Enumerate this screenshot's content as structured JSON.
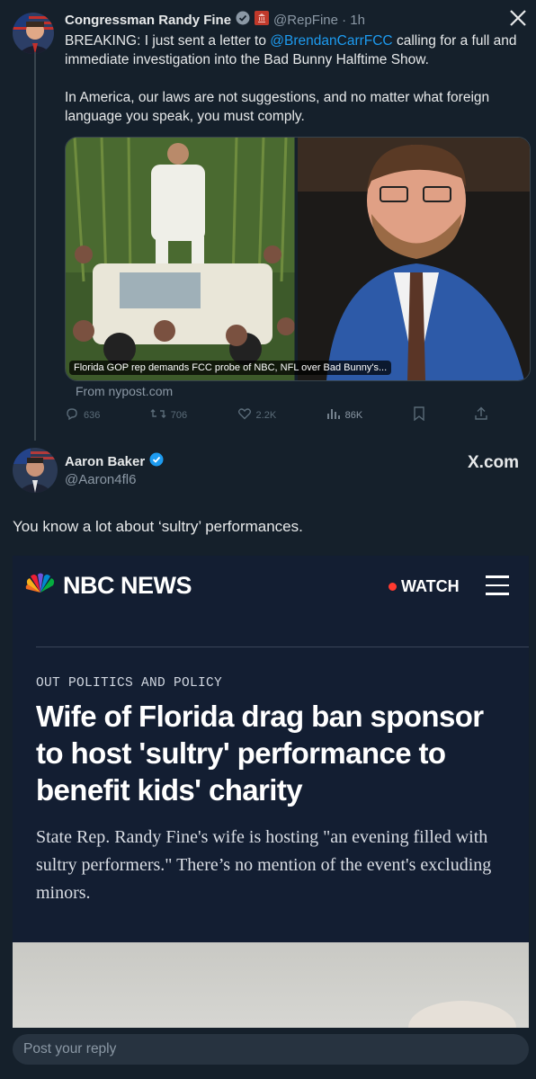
{
  "quoted": {
    "display_name": "Congressman Randy Fine",
    "handle_time": "@RepFine · 1h",
    "text_line1_prefix": "BREAKING: I just sent a letter to ",
    "mention": "@BrendanCarrFCC",
    "text_line1_suffix": " calling for a full and",
    "text_line2": "immediate investigation into the Bad Bunny Halftime Show.",
    "text_para2_line1": "In America, our laws are not suggestions, and no matter what foreign",
    "text_para2_line2": "language you speak, you must comply.",
    "media_caption": "Florida GOP rep demands FCC probe of NBC, NFL over Bad Bunny's...",
    "source": "From nypost.com",
    "stats": {
      "replies": "636",
      "reposts": "706",
      "likes": "2.2K",
      "views": "86K"
    }
  },
  "reply": {
    "display_name": "Aaron Baker",
    "handle": "@Aaron4fl6",
    "site_label": "X.com",
    "text": "You know a lot about ‘sultry’ performances."
  },
  "nbc": {
    "brand": "NBC NEWS",
    "watch_label": "WATCH",
    "kicker": "OUT POLITICS AND POLICY",
    "headline": "Wife of Florida drag ban sponsor to host 'sultry' performance to benefit kids' charity",
    "dek": "State Rep. Randy Fine's wife is hosting \"an evening filled with sultry performers.\" There’s no mention of the event's excluding minors."
  },
  "compose": {
    "placeholder": "Post your reply"
  },
  "colors": {
    "background": "#15202b",
    "link": "#1d9bf0",
    "verified": "#1d9bf0",
    "nbc_bg": "#131e32"
  }
}
